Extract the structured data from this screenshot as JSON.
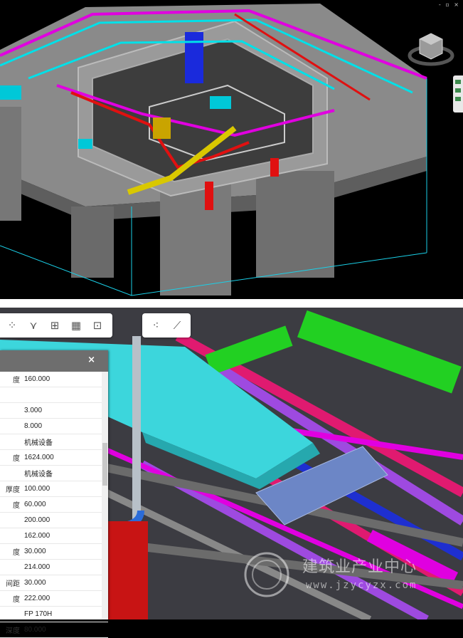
{
  "window": {
    "controls": "- ▫ ×"
  },
  "toolbar": {
    "tools": [
      {
        "icon": "explode-icon",
        "glyph": "⁘"
      },
      {
        "icon": "section-icon",
        "glyph": "⋎"
      },
      {
        "icon": "add-box-icon",
        "glyph": "⊞"
      },
      {
        "icon": "model-tree-icon",
        "glyph": "▦"
      },
      {
        "icon": "focus-icon",
        "glyph": "⊡"
      }
    ],
    "tools2": [
      {
        "icon": "properties-icon",
        "glyph": "⁖"
      },
      {
        "icon": "measure-icon",
        "glyph": "⟋"
      }
    ]
  },
  "properties": {
    "close": "×",
    "rows": [
      {
        "k": "度",
        "v": "160.000"
      },
      {
        "k": "",
        "v": ""
      },
      {
        "k": "",
        "v": "3.000"
      },
      {
        "k": "",
        "v": "8.000"
      },
      {
        "k": "",
        "v": "机械设备"
      },
      {
        "k": "度",
        "v": "1624.000"
      },
      {
        "k": "",
        "v": "机械设备"
      },
      {
        "k": "厚度",
        "v": "100.000"
      },
      {
        "k": "度",
        "v": "60.000"
      },
      {
        "k": "",
        "v": "200.000"
      },
      {
        "k": "",
        "v": "162.000"
      },
      {
        "k": "度",
        "v": "30.000"
      },
      {
        "k": "",
        "v": "214.000"
      },
      {
        "k": "间距",
        "v": "30.000"
      },
      {
        "k": "度",
        "v": "222.000"
      },
      {
        "k": "",
        "v": "FP 170H"
      },
      {
        "k": "深度",
        "v": "80.000"
      }
    ]
  },
  "watermark": {
    "name": "建筑业产业中心",
    "url": "www.jzycyzx.com"
  },
  "colors": {
    "pipe_magenta": "#e000e0",
    "pipe_cyan": "#00e0e8",
    "pipe_red": "#e01010",
    "duct_cyan": "#3cd6dc",
    "equipment_blue": "#1a2adc"
  }
}
